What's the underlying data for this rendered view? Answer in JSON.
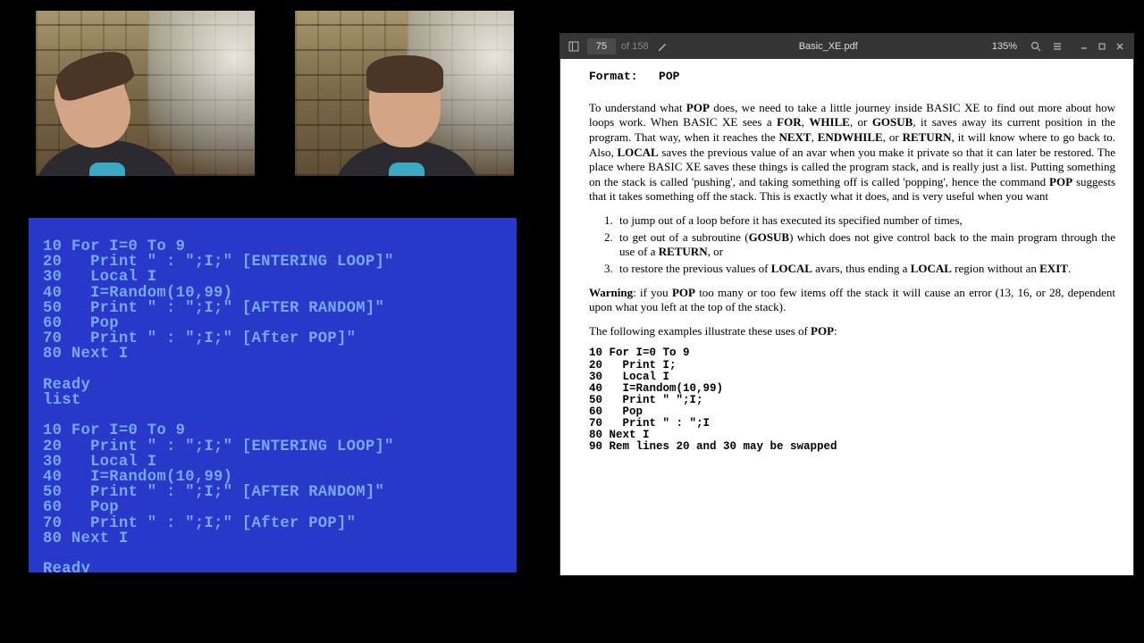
{
  "webcams": {
    "count": 2
  },
  "pdf_viewer": {
    "page_current": "75",
    "page_total": "of 158",
    "filename": "Basic_XE.pdf",
    "zoom": "135%"
  },
  "atari": {
    "code_block": "10 For I=0 To 9\n20   Print \" : \";I;\" [ENTERING LOOP]\"\n30   Local I\n40   I=Random(10,99)\n50   Print \" : \";I;\" [AFTER RANDOM]\"\n60   Pop\n70   Print \" : \";I;\" [After POP]\"\n80 Next I",
    "ready": "Ready",
    "list_cmd": "list"
  },
  "document": {
    "format_label": "Format:",
    "format_value": "POP",
    "para1_a": "To understand what ",
    "para1_b": " does, we need to take a little journey inside BASIC XE to find out more about how loops work.  When BASIC XE sees a ",
    "para1_c": ", it saves away its current position in the program.  That way, when it reaches the ",
    "para1_d": ", it will know where to go back to. Also, ",
    "para1_e": " saves the previous value of an avar when you make it private so that it can later be restored.  The place where BASIC XE saves these things is called the program stack, and is really just a list.  Putting something on the stack is called 'pushing', and taking something off is called 'popping', hence the command ",
    "para1_f": " suggests that it takes something off the stack.  This is exactly what it does, and is very useful when you want",
    "kw_pop": "POP",
    "kw_for": "FOR",
    "kw_while": "WHILE",
    "kw_gosub": "GOSUB",
    "kw_next": "NEXT",
    "kw_endwhile": "ENDWHILE",
    "kw_return": "RETURN",
    "kw_local": "LOCAL",
    "kw_exit": "EXIT",
    "or_sep": ", or ",
    "comma_sep": ", ",
    "li1": "to jump out of a loop before it has executed its specified number of times,",
    "li2_a": "to get out of a subroutine (",
    "li2_b": ") which does not give control back to the main program through the use of a ",
    "li2_c": ", or",
    "li3_a": "to restore the previous values of ",
    "li3_b": " avars, thus ending a ",
    "li3_c": " region without an ",
    "li3_d": ".",
    "warn_label": "Warning",
    "warn_a": ": if you ",
    "warn_b": " too many or too few items off the stack it will cause an error (13, 16, or 28, dependent upon what you left at the top of the stack).",
    "examples_a": "The following examples illustrate these uses of ",
    "examples_b": ":",
    "example_code": "10 For I=0 To 9\n20   Print I;\n30   Local I\n40   I=Random(10,99)\n50   Print \" \";I;\n60   Pop\n70   Print \" : \";I\n80 Next I\n90 Rem lines 20 and 30 may be swapped"
  }
}
